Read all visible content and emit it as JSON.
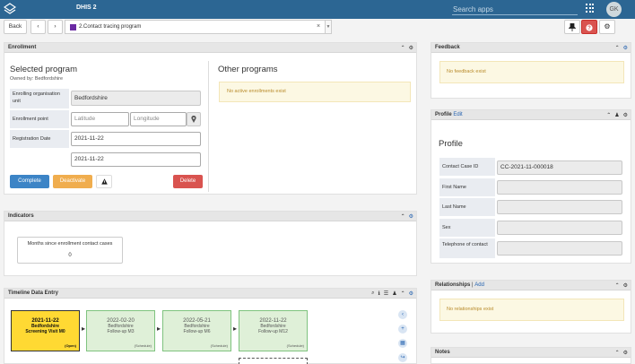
{
  "header": {
    "app_title": "DHIS 2",
    "search_placeholder": "Search apps",
    "user_initials": "GK"
  },
  "toolbar": {
    "back_label": "Back",
    "prev_icon": "chevron-left-icon",
    "next_icon": "chevron-right-icon",
    "program_label": "2.Contact tracing program",
    "program_color": "#6a2aa3",
    "clear_glyph": "×",
    "pin_icon": "pin-icon",
    "help_icon": "help-icon",
    "settings_icon": "gear-icon"
  },
  "enrollment": {
    "title": "Enrollment",
    "selected_heading": "Selected program",
    "owned_by": "Owned by: Bedfordshire",
    "enrolling_label": "Enrolling organisation unit",
    "enrolling_value": "Bedfordshire",
    "point_label": "Enrollment point",
    "latitude_placeholder": "Latitude",
    "longitude_placeholder": "Longitude",
    "registration_label": "Registration Date",
    "registration_value": "2021-11-22",
    "incident_value": "2021-11-22",
    "complete_label": "Complete",
    "deactivate_label": "Deactivate",
    "delete_label": "Delete",
    "other_heading": "Other programs",
    "other_message": "No active enrollments exist"
  },
  "indicators": {
    "title": "Indicators",
    "card_label": "Months since enrollment contact cases",
    "card_value": "0"
  },
  "timeline": {
    "title": "Timeline Data Entry",
    "events": [
      {
        "date": "2021-11-22",
        "org": "Bedfordshire",
        "stage": "Screening Visit M0",
        "status": "(Open)"
      },
      {
        "date": "2022-02-20",
        "org": "Bedfordshire",
        "stage": "Follow-up M3",
        "status": "(Schedule)"
      },
      {
        "date": "2022-05-21",
        "org": "Bedfordshire",
        "stage": "Follow-up M6",
        "status": "(Schedule)"
      },
      {
        "date": "2022-11-22",
        "org": "Bedfordshire",
        "stage": "Follow-up M12",
        "status": "(Schedule)"
      }
    ]
  },
  "feedback": {
    "title": "Feedback",
    "message": "No feedback exist"
  },
  "profile": {
    "title": "Profile",
    "edit_label": "Edit",
    "heading": "Profile",
    "fields": [
      {
        "label": "Contact Case ID",
        "value": "CC-2021-11-000018"
      },
      {
        "label": "First Name",
        "value": ""
      },
      {
        "label": "Last Name",
        "value": ""
      },
      {
        "label": "Sex",
        "value": ""
      },
      {
        "label": "Telephone of contact",
        "value": ""
      }
    ]
  },
  "relationships": {
    "title": "Relationships",
    "separator": "|",
    "add_label": "Add",
    "message": "No relationships exist"
  },
  "notes": {
    "title": "Notes"
  }
}
